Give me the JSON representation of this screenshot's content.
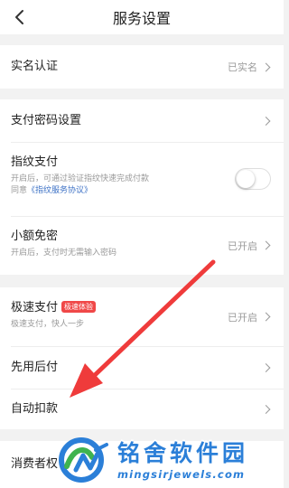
{
  "header": {
    "title": "服务设置",
    "back_icon": "back-chevron-icon"
  },
  "rows": {
    "realname": {
      "title": "实名认证",
      "value": "已实名"
    },
    "paypassword": {
      "title": "支付密码设置"
    },
    "fingerprint": {
      "title": "指纹支付",
      "desc": "开启后，可通过验证指纹快速完成付款",
      "agree_prefix": "同意",
      "agreement": "《指纹服务协议》",
      "toggle_on": false
    },
    "smallfree": {
      "title": "小额免密",
      "desc": "开启后，支付时无需输入密码",
      "value": "已开启"
    },
    "fastpay": {
      "title": "极速支付",
      "badge": "极速体验",
      "desc": "极速支付，快人一步",
      "value": "已开启"
    },
    "paylater": {
      "title": "先用后付"
    },
    "autodeduct": {
      "title": "自动扣款"
    },
    "consumer": {
      "title": "消费者权"
    }
  },
  "watermark": {
    "title": "铭舍软件园",
    "url": "mingsirjewels.com"
  },
  "colors": {
    "background": "#f2f2f2",
    "arrow": "#ef3b3b",
    "link": "#3f73c6",
    "badge": "#f04848",
    "watermark": "#2b7fd8"
  }
}
